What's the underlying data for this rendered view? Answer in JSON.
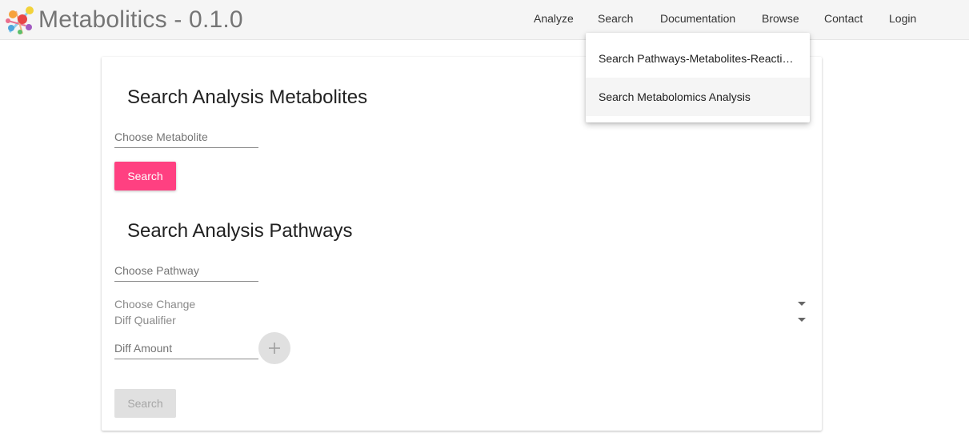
{
  "brand": {
    "title": "Metabolitics - 0.1.0",
    "logo_icon": "molecule-logo-icon"
  },
  "nav": {
    "items": [
      {
        "label": "Analyze"
      },
      {
        "label": "Search"
      },
      {
        "label": "Documentation"
      },
      {
        "label": "Browse"
      },
      {
        "label": "Contact"
      },
      {
        "label": "Login"
      }
    ]
  },
  "search_menu": {
    "items": [
      {
        "label": "Search Pathways-Metabolites-Reactions"
      },
      {
        "label": "Search Metabolomics Analysis",
        "highlighted": true
      }
    ]
  },
  "metabolites_section": {
    "title": "Search Analysis Metabolites",
    "metabolite_placeholder": "Choose Metabolite",
    "search_label": "Search"
  },
  "pathways_section": {
    "title": "Search Analysis Pathways",
    "pathway_placeholder": "Choose Pathway",
    "change_label": "Choose Change",
    "qualifier_label": "Diff Qualifier",
    "amount_placeholder": "Diff Amount",
    "search_label": "Search",
    "search_disabled": true,
    "add_icon": "plus-icon"
  },
  "colors": {
    "accent": "#ff4081",
    "header_bg": "#f5f5f5",
    "disabled_bg": "#e0e0e0"
  }
}
